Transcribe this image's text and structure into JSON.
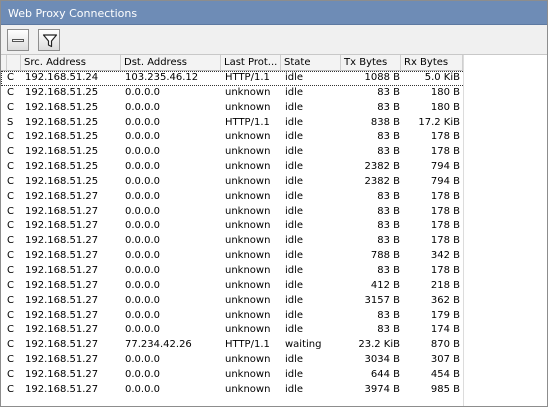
{
  "window": {
    "title": "Web Proxy Connections"
  },
  "toolbar": {
    "remove_icon": "minus-icon",
    "filter_icon": "filter-icon"
  },
  "table": {
    "columns": [
      "",
      "Src. Address",
      "Dst. Address",
      "Last Prot...",
      "State",
      "Tx Bytes",
      "Rx Bytes"
    ],
    "rows": [
      {
        "flag": "C",
        "src": "192.168.51.24",
        "dst": "103.235.46.12",
        "proto": "HTTP/1.1",
        "state": "idle",
        "tx": "1088 B",
        "rx": "5.0 KiB"
      },
      {
        "flag": "C",
        "src": "192.168.51.25",
        "dst": "0.0.0.0",
        "proto": "unknown",
        "state": "idle",
        "tx": "83 B",
        "rx": "180 B"
      },
      {
        "flag": "C",
        "src": "192.168.51.25",
        "dst": "0.0.0.0",
        "proto": "unknown",
        "state": "idle",
        "tx": "83 B",
        "rx": "180 B"
      },
      {
        "flag": "S",
        "src": "192.168.51.25",
        "dst": "0.0.0.0",
        "proto": "HTTP/1.1",
        "state": "idle",
        "tx": "838 B",
        "rx": "17.2 KiB"
      },
      {
        "flag": "C",
        "src": "192.168.51.25",
        "dst": "0.0.0.0",
        "proto": "unknown",
        "state": "idle",
        "tx": "83 B",
        "rx": "178 B"
      },
      {
        "flag": "C",
        "src": "192.168.51.25",
        "dst": "0.0.0.0",
        "proto": "unknown",
        "state": "idle",
        "tx": "83 B",
        "rx": "178 B"
      },
      {
        "flag": "C",
        "src": "192.168.51.25",
        "dst": "0.0.0.0",
        "proto": "unknown",
        "state": "idle",
        "tx": "2382 B",
        "rx": "794 B"
      },
      {
        "flag": "C",
        "src": "192.168.51.25",
        "dst": "0.0.0.0",
        "proto": "unknown",
        "state": "idle",
        "tx": "2382 B",
        "rx": "794 B"
      },
      {
        "flag": "C",
        "src": "192.168.51.27",
        "dst": "0.0.0.0",
        "proto": "unknown",
        "state": "idle",
        "tx": "83 B",
        "rx": "178 B"
      },
      {
        "flag": "C",
        "src": "192.168.51.27",
        "dst": "0.0.0.0",
        "proto": "unknown",
        "state": "idle",
        "tx": "83 B",
        "rx": "178 B"
      },
      {
        "flag": "C",
        "src": "192.168.51.27",
        "dst": "0.0.0.0",
        "proto": "unknown",
        "state": "idle",
        "tx": "83 B",
        "rx": "178 B"
      },
      {
        "flag": "C",
        "src": "192.168.51.27",
        "dst": "0.0.0.0",
        "proto": "unknown",
        "state": "idle",
        "tx": "83 B",
        "rx": "178 B"
      },
      {
        "flag": "C",
        "src": "192.168.51.27",
        "dst": "0.0.0.0",
        "proto": "unknown",
        "state": "idle",
        "tx": "788 B",
        "rx": "342 B"
      },
      {
        "flag": "C",
        "src": "192.168.51.27",
        "dst": "0.0.0.0",
        "proto": "unknown",
        "state": "idle",
        "tx": "83 B",
        "rx": "178 B"
      },
      {
        "flag": "C",
        "src": "192.168.51.27",
        "dst": "0.0.0.0",
        "proto": "unknown",
        "state": "idle",
        "tx": "412 B",
        "rx": "218 B"
      },
      {
        "flag": "C",
        "src": "192.168.51.27",
        "dst": "0.0.0.0",
        "proto": "unknown",
        "state": "idle",
        "tx": "3157 B",
        "rx": "362 B"
      },
      {
        "flag": "C",
        "src": "192.168.51.27",
        "dst": "0.0.0.0",
        "proto": "unknown",
        "state": "idle",
        "tx": "83 B",
        "rx": "179 B"
      },
      {
        "flag": "C",
        "src": "192.168.51.27",
        "dst": "0.0.0.0",
        "proto": "unknown",
        "state": "idle",
        "tx": "83 B",
        "rx": "174 B"
      },
      {
        "flag": "C",
        "src": "192.168.51.27",
        "dst": "77.234.42.26",
        "proto": "HTTP/1.1",
        "state": "waiting",
        "tx": "23.2 KiB",
        "rx": "870 B"
      },
      {
        "flag": "C",
        "src": "192.168.51.27",
        "dst": "0.0.0.0",
        "proto": "unknown",
        "state": "idle",
        "tx": "3034 B",
        "rx": "307 B"
      },
      {
        "flag": "C",
        "src": "192.168.51.27",
        "dst": "0.0.0.0",
        "proto": "unknown",
        "state": "idle",
        "tx": "644 B",
        "rx": "454 B"
      },
      {
        "flag": "C",
        "src": "192.168.51.27",
        "dst": "0.0.0.0",
        "proto": "unknown",
        "state": "idle",
        "tx": "3974 B",
        "rx": "985 B"
      }
    ]
  }
}
